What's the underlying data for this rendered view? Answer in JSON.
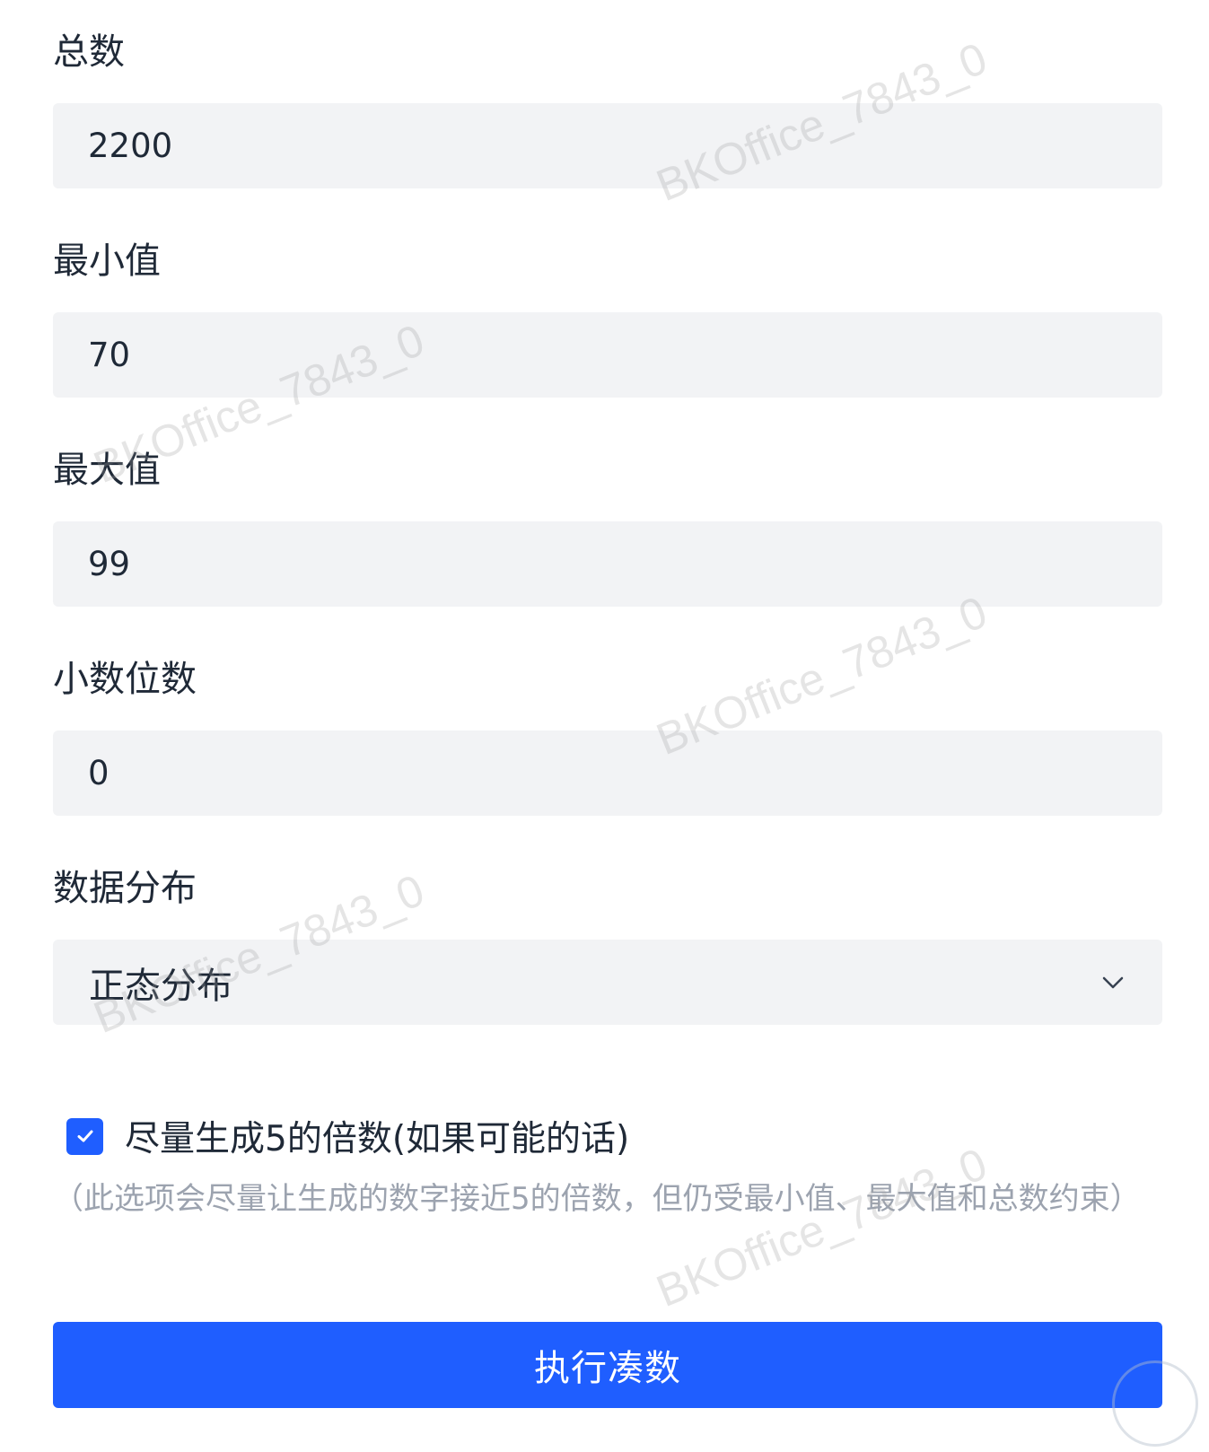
{
  "form": {
    "total": {
      "label": "总数",
      "value": "2200"
    },
    "min": {
      "label": "最小值",
      "value": "70"
    },
    "max": {
      "label": "最大值",
      "value": "99"
    },
    "decimals": {
      "label": "小数位数",
      "value": "0"
    },
    "distribution": {
      "label": "数据分布",
      "selected": "正态分布",
      "icon": "chevron-down-icon"
    },
    "multiple_of_five": {
      "checked": true,
      "label": "尽量生成5的倍数(如果可能的话)",
      "help": "（此选项会尽量让生成的数字接近5的倍数，但仍受最小值、最大值和总数约束）"
    },
    "submit_label": "执行凑数"
  },
  "watermark": "BKOffice_7843_0",
  "colors": {
    "accent": "#1f5eff",
    "input_bg": "#f2f3f5",
    "text": "#1f2937",
    "muted": "#9ca3af"
  }
}
